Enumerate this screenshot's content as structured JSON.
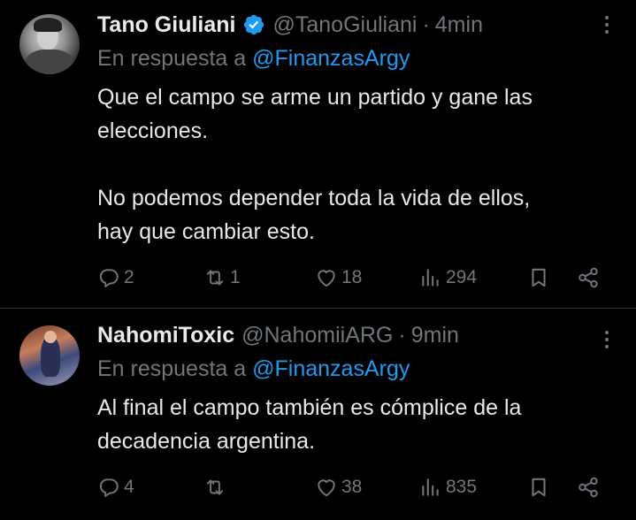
{
  "tweets": [
    {
      "name": "Tano Giuliani",
      "verified": true,
      "handle": "@TanoGiuliani",
      "separator": "·",
      "time": "4min",
      "reply_prefix": "En respuesta a",
      "reply_to": "@FinanzasArgy",
      "text_lines": [
        "Que el campo se arme un partido y gane las",
        "elecciones.",
        "No podemos depender toda la vida de ellos,",
        "hay que cambiar esto."
      ],
      "replies": "2",
      "retweets": "1",
      "likes": "18",
      "views": "294"
    },
    {
      "name": "NahomiToxic",
      "verified": false,
      "handle": "@NahomiiARG",
      "separator": "·",
      "time": "9min",
      "reply_prefix": "En respuesta a",
      "reply_to": "@FinanzasArgy",
      "text_lines": [
        "Al final el campo también es cómplice de la",
        "decadencia argentina."
      ],
      "replies": "4",
      "retweets": "",
      "likes": "38",
      "views": "835"
    }
  ],
  "icons": {
    "more": "more-dots-icon",
    "reply": "reply-icon",
    "retweet": "retweet-icon",
    "like": "heart-icon",
    "views": "views-icon",
    "bookmark": "bookmark-icon",
    "share": "share-icon",
    "verified": "verified-badge-icon"
  },
  "colors": {
    "background": "#000000",
    "text": "#e7e9ea",
    "muted": "#71767b",
    "accent": "#1d9bf0",
    "divider": "#2f3336"
  }
}
